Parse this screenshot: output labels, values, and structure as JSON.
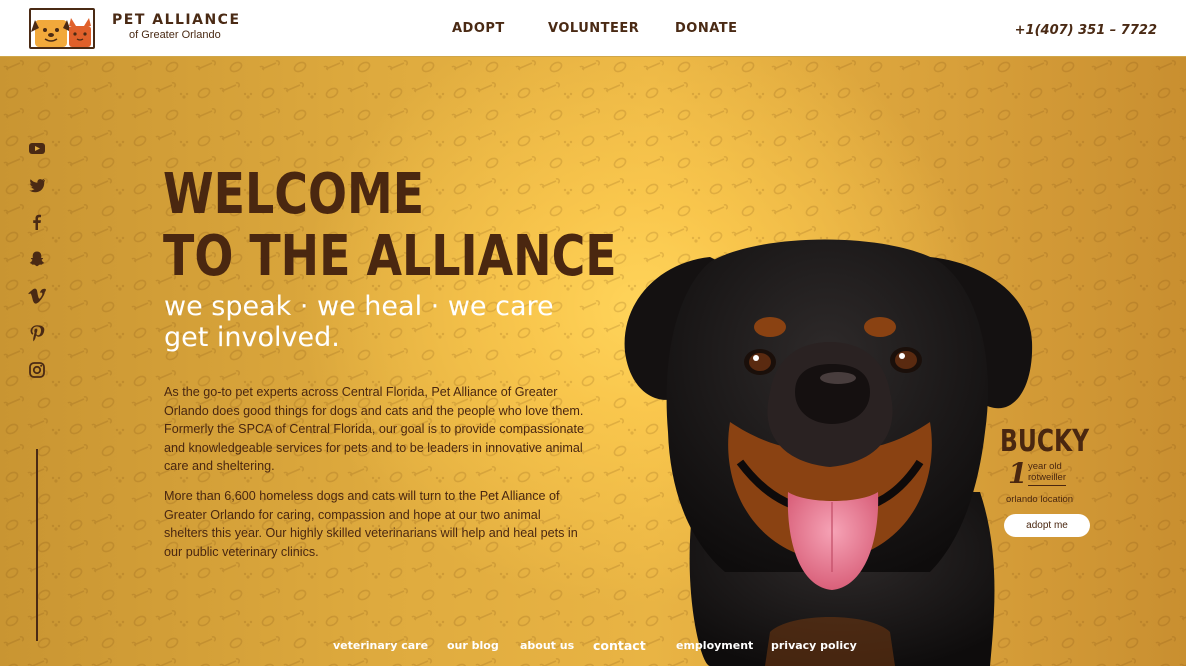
{
  "brand": {
    "title": "PET ALLIANCE",
    "subtitle": "of Greater Orlando",
    "logo_icon": "dog-and-cat-logo-icon"
  },
  "nav": {
    "items": [
      {
        "label": "ADOPT"
      },
      {
        "label": "VOLUNTEER"
      },
      {
        "label": "DONATE"
      }
    ],
    "phone": "+1(407) 351 – 7722"
  },
  "social": {
    "icons": [
      "youtube-icon",
      "twitter-icon",
      "facebook-icon",
      "snapchat-icon",
      "vimeo-icon",
      "pinterest-icon",
      "instagram-icon"
    ]
  },
  "hero": {
    "heading_line1": "WELCOME",
    "heading_line2": "TO THE ALLIANCE",
    "tagline_line1": "we speak · we heal  ·  we care",
    "tagline_line2": "get involved.",
    "paragraph1": "As the go-to pet experts across Central Florida, Pet Alliance of Greater Orlando does good things for dogs and cats and the people who love them. Formerly the SPCA of Central Florida, our goal is to provide compassionate and knowledgeable services for pets and to be leaders in innovative animal care and sheltering.",
    "paragraph2": "More than 6,600 homeless dogs and cats will turn to the Pet Alliance of Greater Orlando for caring, compassion and hope at our two animal shelters this year. Our highly skilled veterinarians will help and heal pets in our public veterinary clinics."
  },
  "featured_pet": {
    "name": "BUCKY",
    "age_number": "1",
    "age_line1": "year old",
    "age_line2": "rotweiller",
    "location": "orlando location",
    "button_label": "adopt me"
  },
  "footer": {
    "links": [
      {
        "label": "veterinary care"
      },
      {
        "label": "our blog"
      },
      {
        "label": "about us"
      },
      {
        "label": "contact"
      },
      {
        "label": "employment"
      },
      {
        "label": "privacy policy"
      }
    ]
  },
  "colors": {
    "brown": "#4a2a14",
    "gold": "#e0ac3f",
    "highlight": "#ffd45a",
    "white": "#ffffff"
  }
}
